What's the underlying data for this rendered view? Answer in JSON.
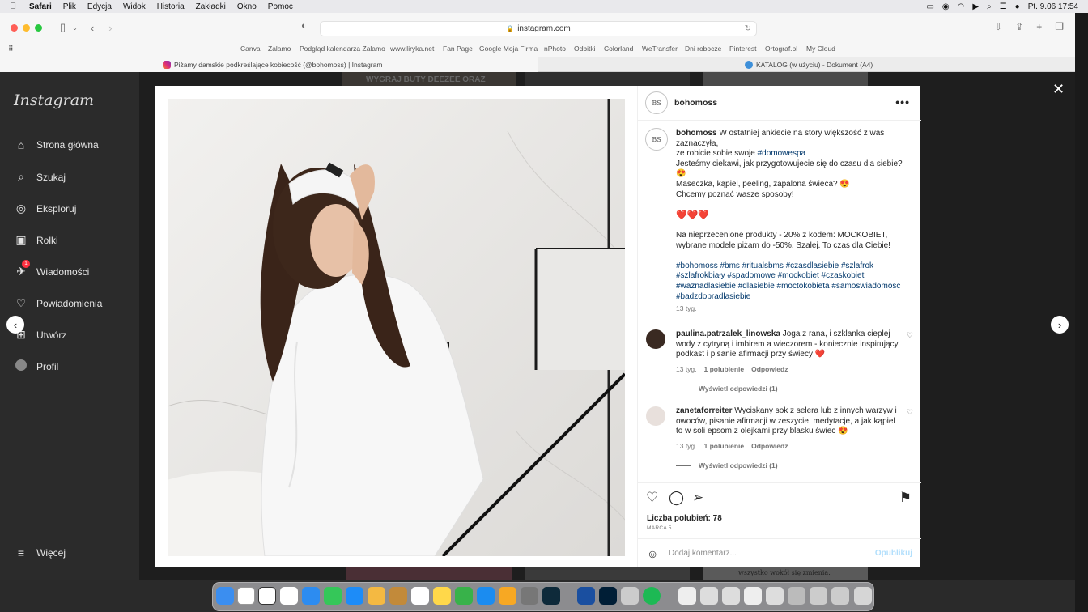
{
  "menubar": {
    "app": "Safari",
    "items": [
      "Plik",
      "Edycja",
      "Widok",
      "Historia",
      "Zakładki",
      "Okno",
      "Pomoc"
    ],
    "datetime": "Pt. 9.06  17:54"
  },
  "browser": {
    "url": "instagram.com",
    "bookmarks": [
      "Canva",
      "Zalamo",
      "Podgląd kalendarza Zalamo",
      "www.liryka.net",
      "Fan Page",
      "Google Moja Firma",
      "nPhoto",
      "Odbitki",
      "Colorland",
      "WeTransfer",
      "Dni robocze",
      "Pinterest",
      "Ortograf.pl",
      "My Cloud"
    ],
    "tabs": [
      {
        "label": "Piżamy damskie podkreślające kobiecość (@bohomoss) | Instagram",
        "active": true
      },
      {
        "label": "KATALOG (w użyciu) - Dokument (A4)",
        "active": false
      }
    ]
  },
  "instagram": {
    "logo": "Instagram",
    "nav": [
      {
        "label": "Strona główna",
        "icon": "home-icon"
      },
      {
        "label": "Szukaj",
        "icon": "search-icon"
      },
      {
        "label": "Eksploruj",
        "icon": "compass-icon"
      },
      {
        "label": "Rolki",
        "icon": "reels-icon"
      },
      {
        "label": "Wiadomości",
        "icon": "messenger-icon",
        "badge": "1"
      },
      {
        "label": "Powiadomienia",
        "icon": "heart-icon"
      },
      {
        "label": "Utwórz",
        "icon": "plus-square-icon"
      },
      {
        "label": "Profil",
        "icon": "profile-avatar"
      }
    ],
    "more": "Więcej",
    "background_text": "WYGRAJ BUTY DEEZEE ORAZ",
    "background_text2": "wszystko wokół się zmienia."
  },
  "post": {
    "username": "bohomoss",
    "avatar_text": "BS",
    "caption": {
      "username": "bohomoss",
      "line1": " W ostatniej ankiecie na story większość z was zaznaczyła,",
      "line2_prefix": "że robicie sobie swoje ",
      "line2_tag": "#domowespa",
      "line3": "Jesteśmy ciekawi, jak przygotowujecie się do czasu dla siebie? 😍",
      "line4": "Maseczka, kąpiel, peeling, zapalona świeca? 😍",
      "line5": "Chcemy poznać wasze sposoby!",
      "hearts": "❤️❤️❤️",
      "promo": "Na nieprzecenione produkty - 20% z kodem: MOCKOBIET, wybrane modele piżam do -50%. Szalej. To czas dla Ciebie!",
      "hashtags": "#bohomoss #bms #ritualsbms #czasdlasiebie #szlafrok #szlafrokbiały #spadomowe #mockobiet #czaskobiet #waznadlasiebie #dlasiebie #moctokobieta #samoswiadomosc #badzdobradlasiebie",
      "time": "13 tyg."
    },
    "comments": [
      {
        "username": "paulina.patrzalek_linowska",
        "text": " Joga z rana, i szklanka cieplej wody z cytryną i imbirem a wieczorem - koniecznie inspirujący podkast i pisanie afirmacji przy świecy ❤️",
        "time": "13 tyg.",
        "likes": "1 polubienie",
        "reply": "Odpowiedz",
        "view_replies": "Wyświetl odpowiedzi (1)"
      },
      {
        "username": "zanetaforreiter",
        "text": " Wyciskany sok z selera lub z innych warzyw i owoców, pisanie afirmacji w zeszycie, medytacje, a jak kąpiel to w soli epsom z olejkami przy blasku świec 😍",
        "time": "13 tyg.",
        "likes": "1 polubienie",
        "reply": "Odpowiedz",
        "view_replies": "Wyświetl odpowiedzi (1)"
      }
    ],
    "likes": "Liczba polubień: 78",
    "date": "MARCA 5",
    "comment_placeholder": "Dodaj komentarz...",
    "post_button": "Opublikuj"
  },
  "colors": {
    "accent_link": "#00376b",
    "post_disabled": "#b2dffc",
    "badge": "#ff3040"
  }
}
